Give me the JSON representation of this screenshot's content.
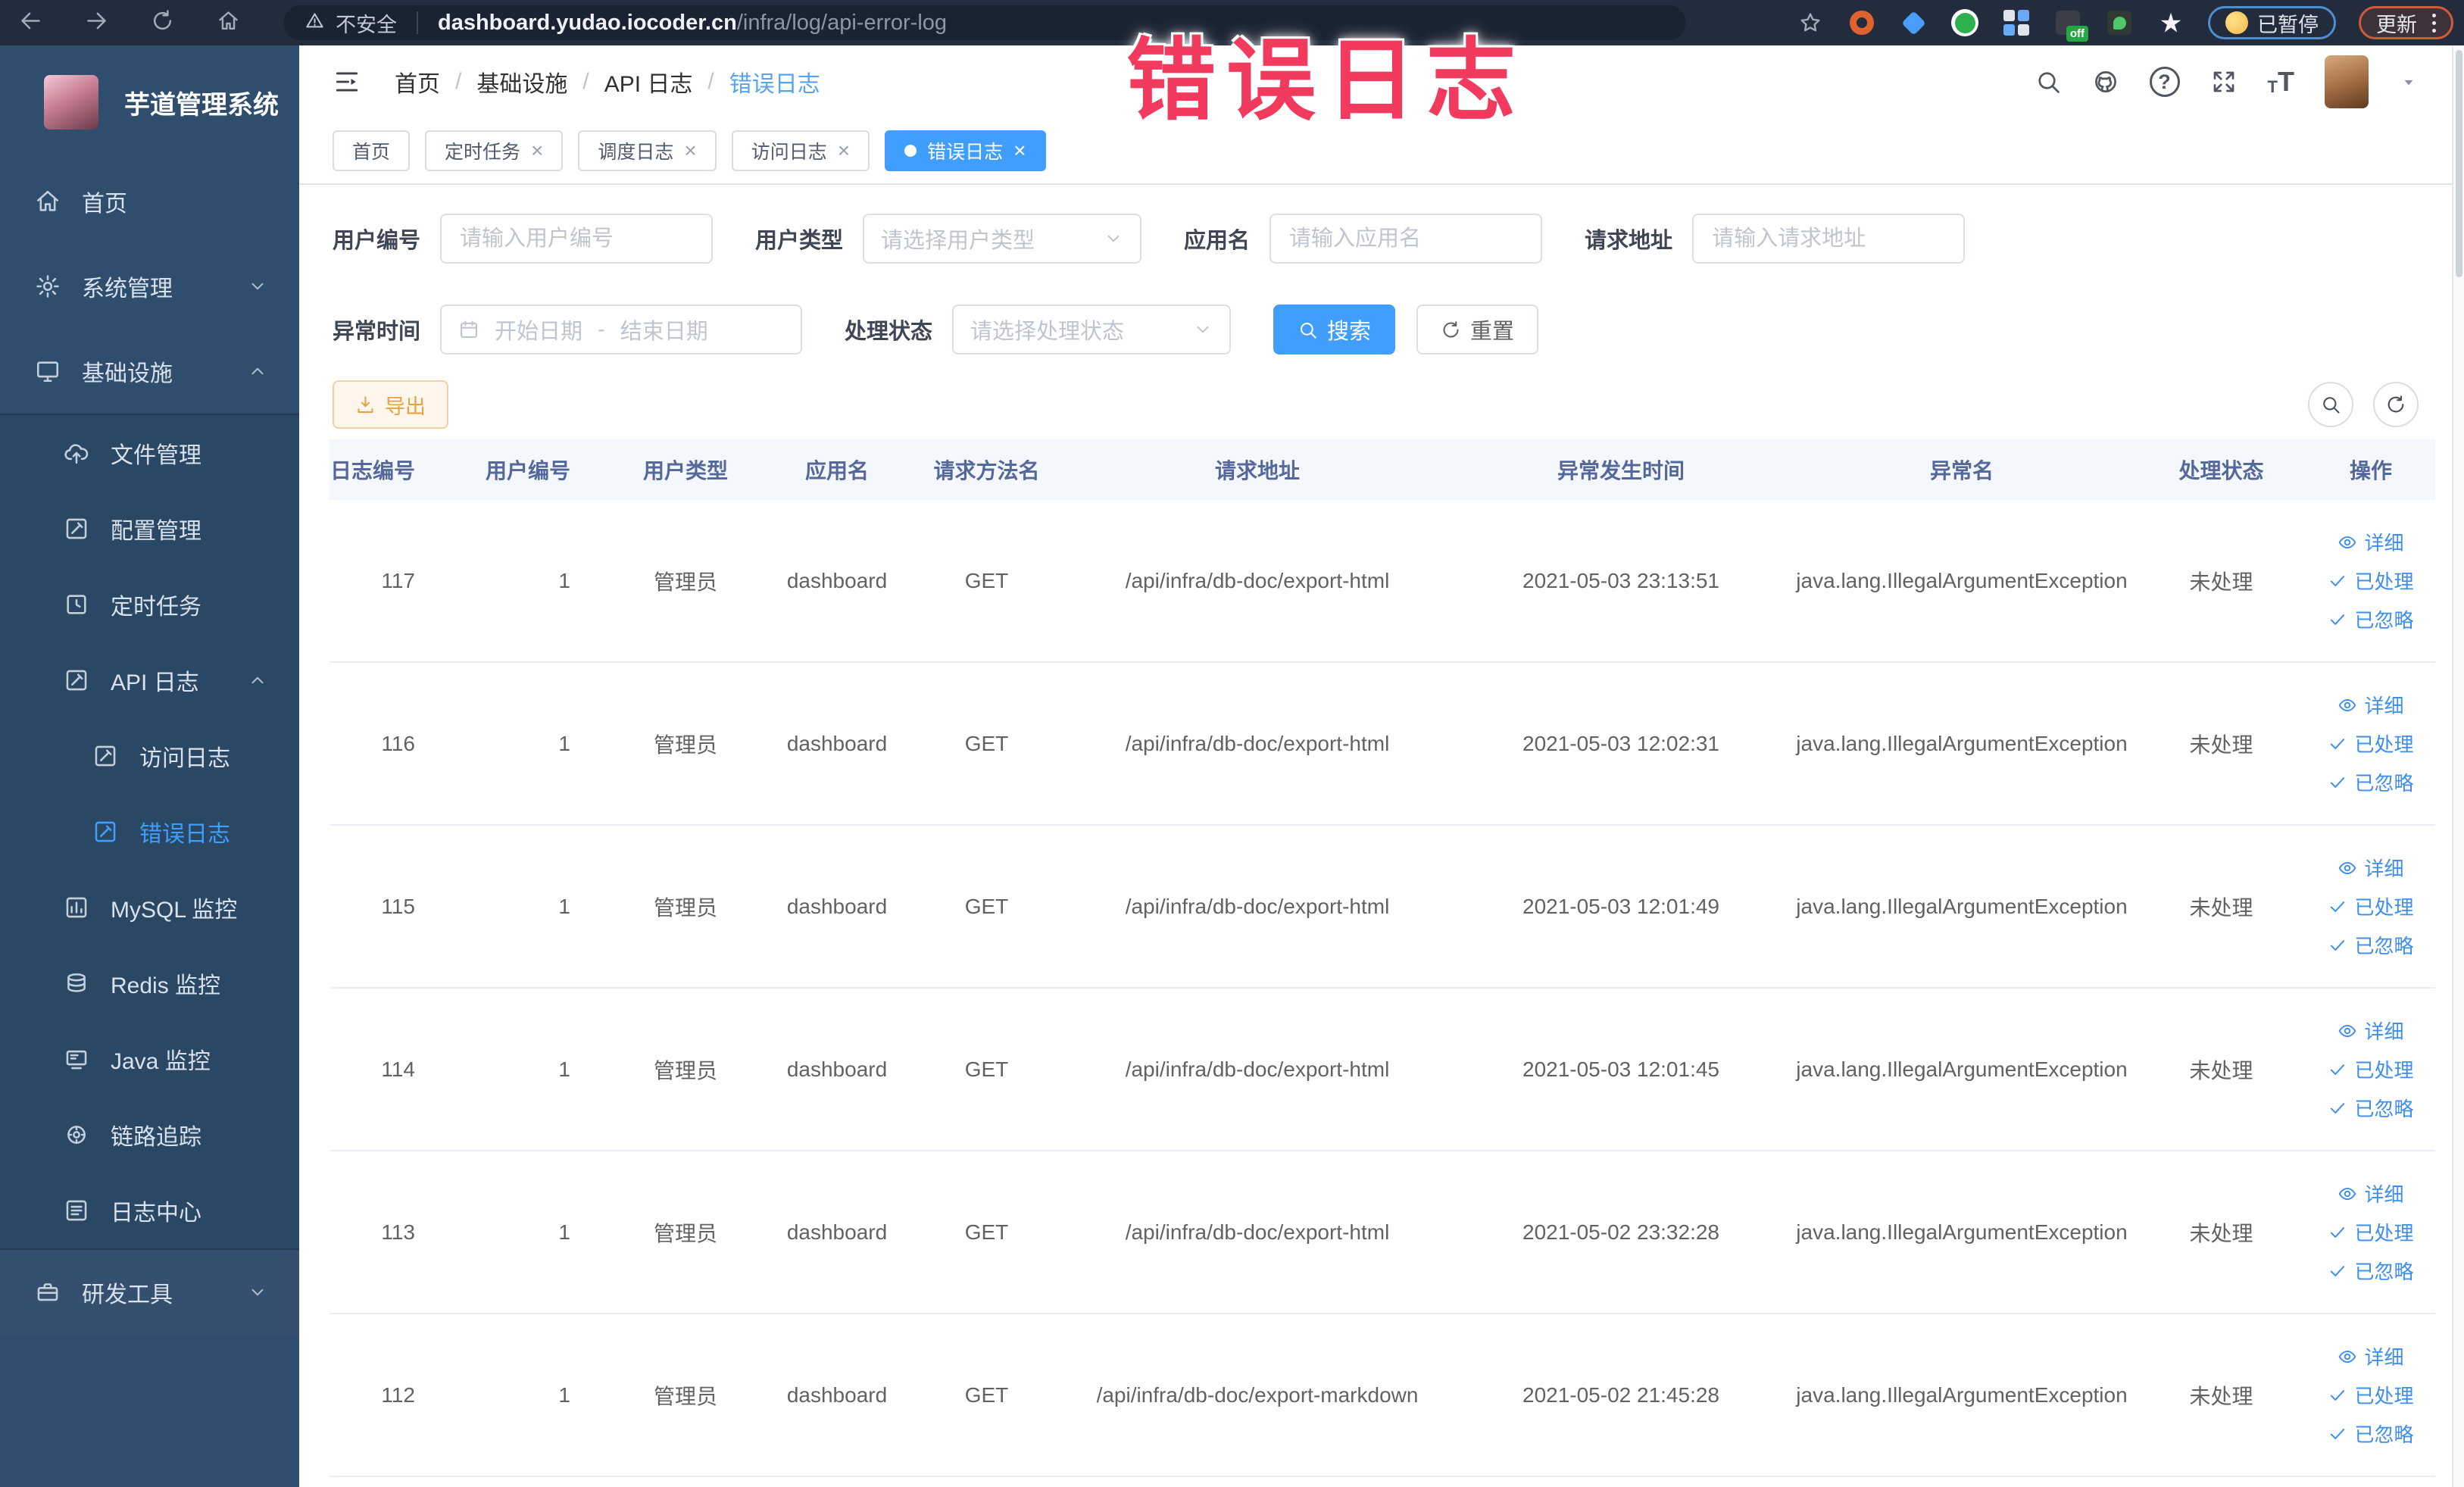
{
  "browser": {
    "security_label": "不安全",
    "url_domain": "dashboard.yudao.iocoder.cn",
    "url_path": "/infra/log/api-error-log",
    "paused_label": "已暂停",
    "update_label": "更新"
  },
  "annotation": {
    "text": "错误日志"
  },
  "colors": {
    "accent": "#409eff",
    "annotation_red": "#f23a5f",
    "warning_orange": "#e6a23c",
    "sidebar_bg": "#2f4e6e"
  },
  "sidebar": {
    "title": "芋道管理系统",
    "items": [
      {
        "name": "home",
        "label": "首页",
        "icon": "home",
        "level": 1
      },
      {
        "name": "system-mgmt",
        "label": "系统管理",
        "icon": "gear",
        "level": 1,
        "chevron": "down"
      },
      {
        "name": "infrastructure",
        "label": "基础设施",
        "icon": "monitor",
        "level": 1,
        "chevron": "up"
      },
      {
        "name": "file-mgmt",
        "label": "文件管理",
        "icon": "cloud-upload",
        "level": 2,
        "sub": true,
        "divider_before": true
      },
      {
        "name": "config-mgmt",
        "label": "配置管理",
        "icon": "edit-square",
        "level": 2,
        "sub": true
      },
      {
        "name": "scheduled-jobs",
        "label": "定时任务",
        "icon": "timer",
        "level": 2,
        "sub": true
      },
      {
        "name": "api-log",
        "label": "API 日志",
        "icon": "edit-square",
        "level": 2,
        "sub": true,
        "chevron": "up"
      },
      {
        "name": "access-log",
        "label": "访问日志",
        "icon": "edit-square",
        "level": 3,
        "sub": true
      },
      {
        "name": "error-log",
        "label": "错误日志",
        "icon": "edit-square",
        "level": 3,
        "sub": true,
        "active": true
      },
      {
        "name": "mysql-monitor",
        "label": "MySQL 监控",
        "icon": "mysql",
        "level": 2,
        "sub": true
      },
      {
        "name": "redis-monitor",
        "label": "Redis 监控",
        "icon": "redis",
        "level": 2,
        "sub": true
      },
      {
        "name": "java-monitor",
        "label": "Java 监控",
        "icon": "java",
        "level": 2,
        "sub": true
      },
      {
        "name": "trace",
        "label": "链路追踪",
        "icon": "trace",
        "level": 2,
        "sub": true
      },
      {
        "name": "log-center",
        "label": "日志中心",
        "icon": "log-center",
        "level": 2,
        "sub": true
      },
      {
        "name": "dev-tools",
        "label": "研发工具",
        "icon": "toolbox",
        "level": 1,
        "chevron": "down",
        "bottom": true,
        "divider_before": true
      }
    ]
  },
  "header": {
    "breadcrumb": [
      "首页",
      "基础设施",
      "API 日志",
      "错误日志"
    ]
  },
  "tabs": [
    {
      "name": "home",
      "label": "首页",
      "closable": false,
      "active": false
    },
    {
      "name": "job",
      "label": "定时任务",
      "closable": true,
      "active": false
    },
    {
      "name": "job-log",
      "label": "调度日志",
      "closable": true,
      "active": false
    },
    {
      "name": "access-log",
      "label": "访问日志",
      "closable": true,
      "active": false
    },
    {
      "name": "error-log",
      "label": "错误日志",
      "closable": true,
      "active": true
    }
  ],
  "filters": {
    "user_id_label": "用户编号",
    "user_id_placeholder": "请输入用户编号",
    "user_type_label": "用户类型",
    "user_type_placeholder": "请选择用户类型",
    "app_name_label": "应用名",
    "app_name_placeholder": "请输入应用名",
    "request_url_label": "请求地址",
    "request_url_placeholder": "请输入请求地址",
    "exception_time_label": "异常时间",
    "date_start_placeholder": "开始日期",
    "date_separator": "-",
    "date_end_placeholder": "结束日期",
    "process_status_label": "处理状态",
    "process_status_placeholder": "请选择处理状态",
    "search_label": "搜索",
    "reset_label": "重置"
  },
  "toolbar": {
    "export_label": "导出"
  },
  "table": {
    "headers": [
      "日志编号",
      "用户编号",
      "用户类型",
      "应用名",
      "请求方法名",
      "请求地址",
      "异常发生时间",
      "异常名",
      "处理状态",
      "操作"
    ],
    "actions": [
      "详细",
      "已处理",
      "已忽略"
    ],
    "rows": [
      {
        "log_id": "117",
        "user_id": "1",
        "user_type": "管理员",
        "app": "dashboard",
        "method": "GET",
        "url": "/api/infra/db-doc/export-html",
        "time": "2021-05-03 23:13:51",
        "exception": "java.lang.IllegalArgumentException",
        "status": "未处理"
      },
      {
        "log_id": "116",
        "user_id": "1",
        "user_type": "管理员",
        "app": "dashboard",
        "method": "GET",
        "url": "/api/infra/db-doc/export-html",
        "time": "2021-05-03 12:02:31",
        "exception": "java.lang.IllegalArgumentException",
        "status": "未处理"
      },
      {
        "log_id": "115",
        "user_id": "1",
        "user_type": "管理员",
        "app": "dashboard",
        "method": "GET",
        "url": "/api/infra/db-doc/export-html",
        "time": "2021-05-03 12:01:49",
        "exception": "java.lang.IllegalArgumentException",
        "status": "未处理"
      },
      {
        "log_id": "114",
        "user_id": "1",
        "user_type": "管理员",
        "app": "dashboard",
        "method": "GET",
        "url": "/api/infra/db-doc/export-html",
        "time": "2021-05-03 12:01:45",
        "exception": "java.lang.IllegalArgumentException",
        "status": "未处理"
      },
      {
        "log_id": "113",
        "user_id": "1",
        "user_type": "管理员",
        "app": "dashboard",
        "method": "GET",
        "url": "/api/infra/db-doc/export-html",
        "time": "2021-05-02 23:32:28",
        "exception": "java.lang.IllegalArgumentException",
        "status": "未处理"
      },
      {
        "log_id": "112",
        "user_id": "1",
        "user_type": "管理员",
        "app": "dashboard",
        "method": "GET",
        "url": "/api/infra/db-doc/export-markdown",
        "time": "2021-05-02 21:45:28",
        "exception": "java.lang.IllegalArgumentException",
        "status": "未处理"
      }
    ]
  }
}
